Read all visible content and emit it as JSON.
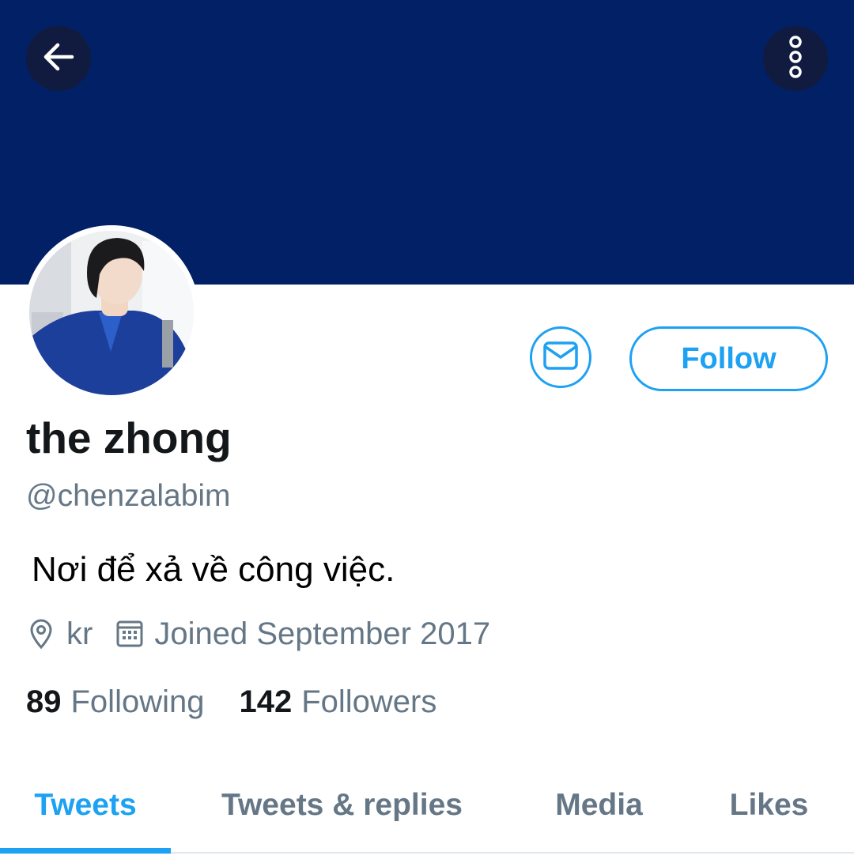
{
  "colors": {
    "banner": "#022065",
    "accent": "#1da1f2",
    "primary_text": "#14171a",
    "secondary_text": "#657786"
  },
  "header": {
    "back_icon": "arrow-left-icon",
    "more_icon": "vertical-dots-icon"
  },
  "profile": {
    "display_name": "the zhong",
    "handle": "@chenzalabim",
    "bio": "Nơi để xả về công việc.",
    "location": "kr",
    "location_icon": "location-pin-icon",
    "joined": "Joined September 2017",
    "joined_icon": "calendar-icon",
    "following_count": "89",
    "following_label": "Following",
    "followers_count": "142",
    "followers_label": "Followers"
  },
  "actions": {
    "message_icon": "envelope-icon",
    "follow_label": "Follow"
  },
  "tabs": [
    {
      "label": "Tweets",
      "active": true
    },
    {
      "label": "Tweets & replies",
      "active": false
    },
    {
      "label": "Media",
      "active": false
    },
    {
      "label": "Likes",
      "active": false
    }
  ]
}
